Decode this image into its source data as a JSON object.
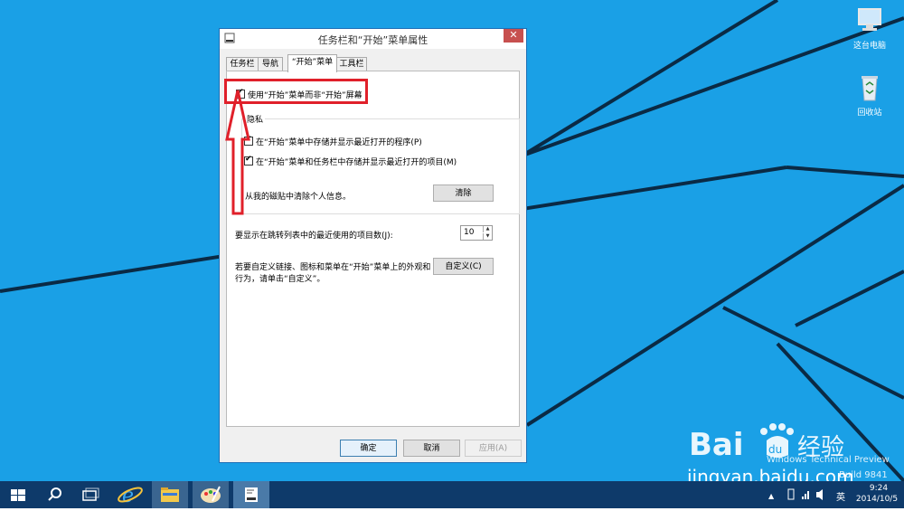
{
  "desktop": {
    "icons": [
      {
        "label": "这台电脑",
        "icon": "computer-icon"
      },
      {
        "label": "回收站",
        "icon": "recycle-bin-icon"
      }
    ],
    "watermark": {
      "line1": "Windows Technical Preview",
      "line2": "Build 9841",
      "logo_text": "Bai du 经验",
      "url": "jingyan.baidu.com"
    }
  },
  "dialog": {
    "title": "任务栏和“开始”菜单属性",
    "close_label": "✕",
    "tabs": [
      {
        "label": "任务栏",
        "active": false
      },
      {
        "label": "导航",
        "active": false
      },
      {
        "label": "“开始”菜单",
        "active": true
      },
      {
        "label": "工具栏",
        "active": false
      }
    ],
    "use_start_menu": {
      "label": "使用“开始”菜单而非“开始”屏幕",
      "checked": true
    },
    "privacy": {
      "title": "隐私",
      "store_programs": {
        "label": "在“开始”菜单中存储并显示最近打开的程序(P)",
        "checked": true
      },
      "store_items": {
        "label": "在“开始”菜单和任务栏中存储并显示最近打开的项目(M)",
        "checked": true
      },
      "clear_text": "从我的磁贴中清除个人信息。",
      "clear_button": "清除"
    },
    "jump_list": {
      "label": "要显示在跳转列表中的最近使用的项目数(J):",
      "value": "10"
    },
    "customize": {
      "text_line1": "若要自定义链接、图标和菜单在“开始”菜单上的外观和",
      "text_line2": "行为，请单击“自定义”。",
      "button": "自定义(C)"
    },
    "buttons": {
      "ok": "确定",
      "cancel": "取消",
      "apply": "应用(A)"
    }
  },
  "taskbar": {
    "items": [
      "start-icon",
      "search-icon",
      "task-view-icon",
      "internet-explorer-icon",
      "file-explorer-icon",
      "paint-icon",
      "taskbar-properties-icon"
    ],
    "tray": {
      "ime": "英",
      "time": "9:24",
      "date": "2014/10/5"
    }
  },
  "colors": {
    "desktop": "#1aa0e6",
    "taskbar": "#0e3a6a",
    "highlight": "#e0202a",
    "close": "#c7504f"
  }
}
